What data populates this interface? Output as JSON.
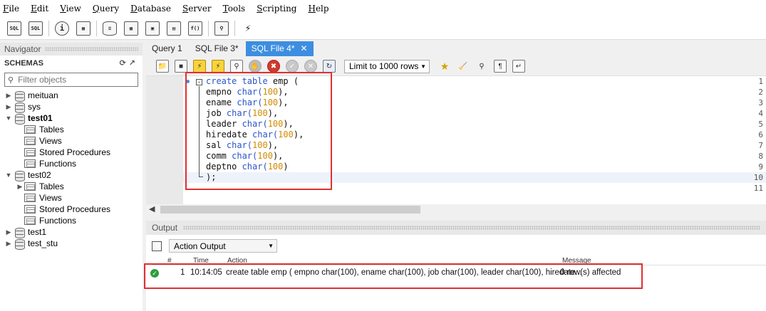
{
  "menu": [
    "File",
    "Edit",
    "View",
    "Query",
    "Database",
    "Server",
    "Tools",
    "Scripting",
    "Help"
  ],
  "toolbar": {
    "icons": [
      "new-sql-tab-icon",
      "open-sql-script-icon",
      "info-icon",
      "create-schema-icon",
      "create-table-icon",
      "create-view-icon",
      "create-procedure-icon",
      "create-function-icon",
      "search-table-data-icon",
      "reconnect-icon"
    ]
  },
  "navigator": {
    "title": "Navigator",
    "schemas_label": "SCHEMAS",
    "filter_placeholder": "Filter objects",
    "tree": [
      {
        "label": "meituan",
        "expanded": false
      },
      {
        "label": "sys",
        "expanded": false
      },
      {
        "label": "test01",
        "expanded": true,
        "bold": true,
        "children": [
          "Tables",
          "Views",
          "Stored Procedures",
          "Functions"
        ]
      },
      {
        "label": "test02",
        "expanded": true,
        "children": [
          "Tables",
          "Views",
          "Stored Procedures",
          "Functions"
        ]
      },
      {
        "label": "test1",
        "expanded": false
      },
      {
        "label": "test_stu",
        "expanded": false
      }
    ]
  },
  "tabs": [
    {
      "label": "Query 1",
      "active": false
    },
    {
      "label": "SQL File 3*",
      "active": false
    },
    {
      "label": "SQL File 4*",
      "active": true
    }
  ],
  "sql_toolbar": {
    "limit_label": "Limit to 1000 rows"
  },
  "editor": {
    "line_numbers": [
      "1",
      "2",
      "3",
      "4",
      "5",
      "6",
      "7",
      "8",
      "9",
      "10",
      "11"
    ],
    "lines": [
      [
        {
          "t": "create table ",
          "c": "kw"
        },
        {
          "t": "emp (",
          "c": ""
        }
      ],
      [
        {
          "t": "empno ",
          "c": ""
        },
        {
          "t": "char(",
          "c": "kw"
        },
        {
          "t": "100",
          "c": "num"
        },
        {
          "t": "),",
          "c": ""
        }
      ],
      [
        {
          "t": "ename ",
          "c": ""
        },
        {
          "t": "char(",
          "c": "kw"
        },
        {
          "t": "100",
          "c": "num"
        },
        {
          "t": "),",
          "c": ""
        }
      ],
      [
        {
          "t": "job ",
          "c": ""
        },
        {
          "t": "char(",
          "c": "kw"
        },
        {
          "t": "100",
          "c": "num"
        },
        {
          "t": "),",
          "c": ""
        }
      ],
      [
        {
          "t": "leader ",
          "c": ""
        },
        {
          "t": "char(",
          "c": "kw"
        },
        {
          "t": "100",
          "c": "num"
        },
        {
          "t": "),",
          "c": ""
        }
      ],
      [
        {
          "t": "hiredate ",
          "c": ""
        },
        {
          "t": "char(",
          "c": "kw"
        },
        {
          "t": "100",
          "c": "num"
        },
        {
          "t": "),",
          "c": ""
        }
      ],
      [
        {
          "t": "sal ",
          "c": ""
        },
        {
          "t": "char(",
          "c": "kw"
        },
        {
          "t": "100",
          "c": "num"
        },
        {
          "t": "),",
          "c": ""
        }
      ],
      [
        {
          "t": "comm ",
          "c": ""
        },
        {
          "t": "char(",
          "c": "kw"
        },
        {
          "t": "100",
          "c": "num"
        },
        {
          "t": "),",
          "c": ""
        }
      ],
      [
        {
          "t": "deptno ",
          "c": ""
        },
        {
          "t": "char(",
          "c": "kw"
        },
        {
          "t": "100",
          "c": "num"
        },
        {
          "t": ")",
          "c": ""
        }
      ],
      [
        {
          "t": ");",
          "c": ""
        }
      ],
      []
    ]
  },
  "output": {
    "title": "Output",
    "selector": "Action Output",
    "columns": {
      "num": "#",
      "time": "Time",
      "action": "Action",
      "message": "Message"
    },
    "rows": [
      {
        "num": "1",
        "time": "10:14:05",
        "action": "create table emp ( empno char(100), ename char(100), job char(100), leader char(100), hiredate...",
        "message": "0 row(s) affected",
        "status": "success"
      }
    ]
  },
  "colors": {
    "accent": "#3d8ee0",
    "highlight_border": "#e03030",
    "success": "#2e9e3e"
  }
}
